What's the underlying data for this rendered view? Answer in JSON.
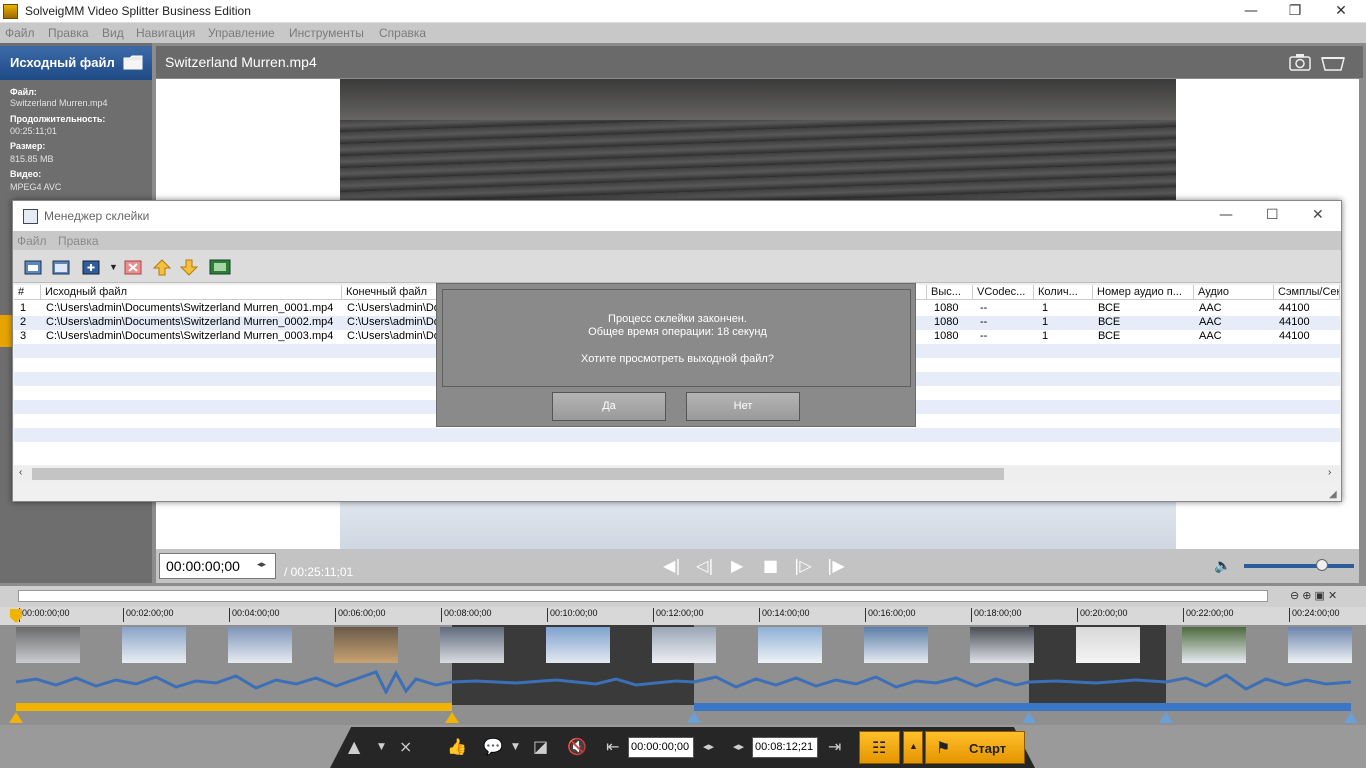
{
  "app": {
    "title": "SolveigMM Video Splitter Business Edition"
  },
  "menu": [
    "Файл",
    "Правка",
    "Вид",
    "Навигация",
    "Управление",
    "Инструменты",
    "Справка"
  ],
  "source_panel": {
    "title": "Исходный файл",
    "info": [
      {
        "label": "Файл:",
        "value": "Switzerland Murren.mp4"
      },
      {
        "label": "Продолжительность:",
        "value": "00:25:11;01"
      },
      {
        "label": "Размер:",
        "value": "815.85 MB"
      },
      {
        "label": "Видео:",
        "value": "MPEG4 AVC"
      }
    ]
  },
  "main": {
    "filename": "Switzerland Murren.mp4"
  },
  "player": {
    "timecode": "00:00:00;00",
    "duration": "/ 00:25:11;01"
  },
  "timeline": {
    "ticks": [
      "00:00:00;00",
      "00:02:00;00",
      "00:04:00;00",
      "00:06:00;00",
      "00:08:00;00",
      "00:10:00;00",
      "00:12:00;00",
      "00:14:00;00",
      "00:16:00;00",
      "00:18:00;00",
      "00:20:00;00",
      "00:22:00;00",
      "00:24:00;00"
    ]
  },
  "bottom": {
    "time_in": "00:00:00;00",
    "time_out": "00:08:12;21",
    "start_label": "Старт"
  },
  "merge_manager": {
    "title": "Менеджер склейки",
    "menu": [
      "Файл",
      "Правка"
    ],
    "columns": [
      "#",
      "Исходный файл",
      "Конечный файл",
      "Выс...",
      "VCodec...",
      "Колич...",
      "Номер аудио п...",
      "Аудио",
      "Сэмплы/Сек"
    ],
    "rows": [
      {
        "n": "1",
        "src": "C:\\Users\\admin\\Documents\\Switzerland Murren_0001.mp4",
        "dst": "C:\\Users\\admin\\Do",
        "h": "1080",
        "vcodec": "--",
        "count": "1",
        "audio_n": "ВСЕ",
        "audio": "AAC",
        "rate": "44100"
      },
      {
        "n": "2",
        "src": "C:\\Users\\admin\\Documents\\Switzerland Murren_0002.mp4",
        "dst": "C:\\Users\\admin\\Do",
        "h": "1080",
        "vcodec": "--",
        "count": "1",
        "audio_n": "ВСЕ",
        "audio": "AAC",
        "rate": "44100"
      },
      {
        "n": "3",
        "src": "C:\\Users\\admin\\Documents\\Switzerland Murren_0003.mp4",
        "dst": "C:\\Users\\admin\\Do",
        "h": "1080",
        "vcodec": "--",
        "count": "1",
        "audio_n": "ВСЕ",
        "audio": "AAC",
        "rate": "44100"
      }
    ]
  },
  "dialog": {
    "line1": "Процесс склейки закончен.",
    "line2": "Общее время операции: 18 секунд",
    "question": "Хотите просмотреть выходной файл?",
    "yes": "Да",
    "no": "Нет"
  }
}
